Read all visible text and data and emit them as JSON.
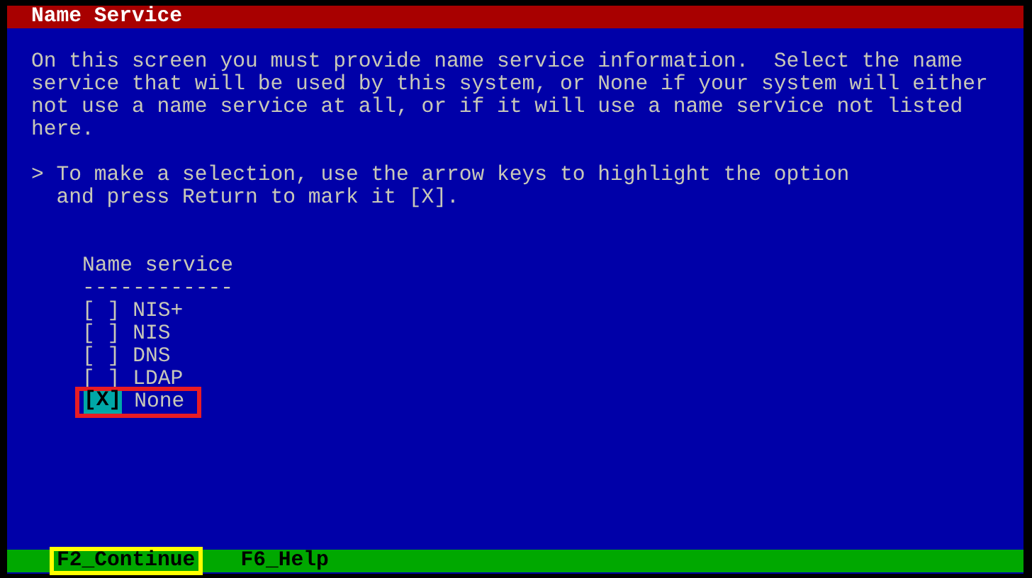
{
  "title": "Name Service",
  "intro": [
    "On this screen you must provide name service information.  Select the name",
    "service that will be used by this system, or None if your system will either",
    "not use a name service at all, or if it will use a name service not listed",
    "here."
  ],
  "instruction": [
    "> To make a selection, use the arrow keys to highlight the option",
    "  and press Return to mark it [X]."
  ],
  "list": {
    "heading": "Name service",
    "rule": "------------",
    "options": [
      {
        "box": "[ ]",
        "label": "NIS+",
        "focused": false,
        "annotated": false
      },
      {
        "box": "[ ]",
        "label": "NIS",
        "focused": false,
        "annotated": false
      },
      {
        "box": "[ ]",
        "label": "DNS",
        "focused": false,
        "annotated": false
      },
      {
        "box": "[ ]",
        "label": "LDAP",
        "focused": false,
        "annotated": false
      },
      {
        "box": "[X]",
        "label": "None",
        "focused": true,
        "annotated": true
      }
    ]
  },
  "function_keys": [
    {
      "label": "F2_Continue",
      "annotated": true
    },
    {
      "label": "F6_Help",
      "annotated": false
    }
  ]
}
